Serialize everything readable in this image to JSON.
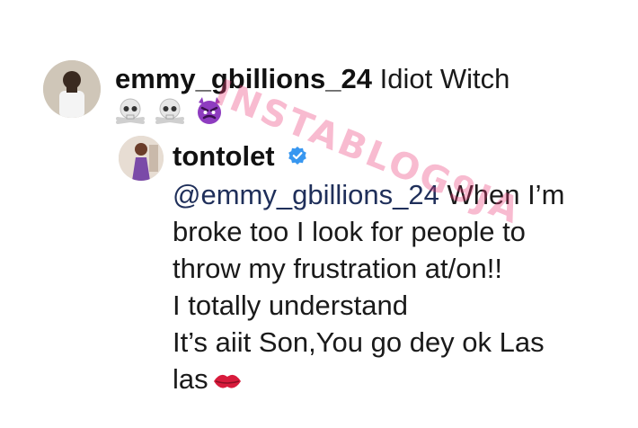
{
  "comment": {
    "username": "emmy_gbillions_24",
    "text": "Idiot Witch",
    "emojis": [
      "skull-crossbones",
      "skull-crossbones",
      "angry-devil"
    ]
  },
  "reply": {
    "username": "tontolet",
    "verified": true,
    "mention": "@emmy_gbillions_24",
    "line1_rest": "When I’m",
    "line2": "broke too I look for people to",
    "line3": "throw my frustration at/on!!",
    "line4": "I totally understand",
    "line5": "It’s aiit Son,You go dey ok Las",
    "line6": "las",
    "end_emoji": "kiss-mark"
  },
  "watermark": "INSTABLOG9JA",
  "colors": {
    "verified_badge": "#3897f0",
    "devil": "#8e3cc0",
    "kiss": "#d81b3c",
    "watermark": "#ec3c78"
  }
}
